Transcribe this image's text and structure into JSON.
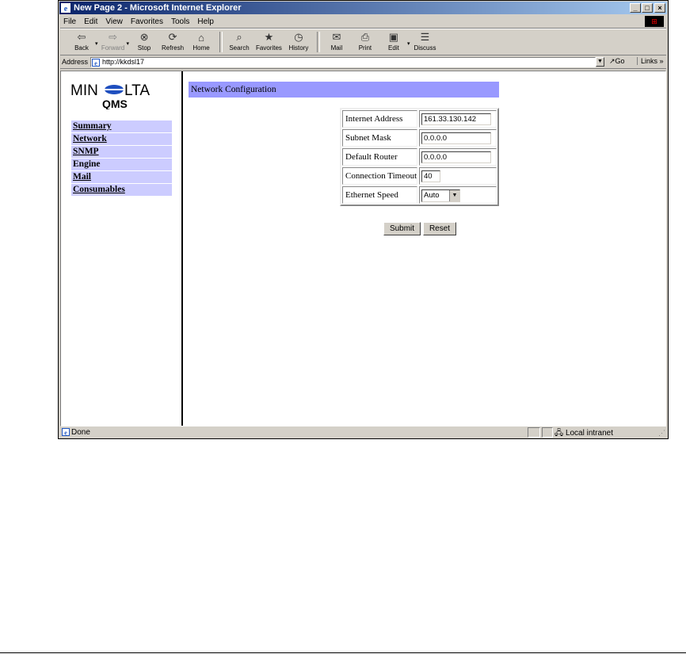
{
  "window": {
    "title": "New Page 2 - Microsoft Internet Explorer",
    "minimize": "_",
    "maximize": "□",
    "close": "×"
  },
  "menu": [
    "File",
    "Edit",
    "View",
    "Favorites",
    "Tools",
    "Help"
  ],
  "toolbar": {
    "back": "Back",
    "forward": "Forward",
    "stop": "Stop",
    "refresh": "Refresh",
    "home": "Home",
    "search": "Search",
    "favorites": "Favorites",
    "history": "History",
    "mail": "Mail",
    "print": "Print",
    "edit": "Edit",
    "discuss": "Discuss"
  },
  "address": {
    "label": "Address",
    "url": "http://kkdsl17",
    "go": "Go",
    "links": "Links »"
  },
  "logo": {
    "line1": "MINOLTA",
    "line2": "QMS"
  },
  "nav": [
    "Summary",
    "Network",
    "SNMP",
    "Engine",
    "Mail",
    "Consumables"
  ],
  "page": {
    "heading": "Network Configuration",
    "fields": [
      {
        "label": "Internet Address",
        "value": "161.33.130.142"
      },
      {
        "label": "Subnet Mask",
        "value": "0.0.0.0"
      },
      {
        "label": "Default Router",
        "value": "0.0.0.0"
      },
      {
        "label": "Connection Timeout",
        "value": "40"
      },
      {
        "label": "Ethernet Speed",
        "value": "Auto"
      }
    ],
    "submit": "Submit",
    "reset": "Reset"
  },
  "status": {
    "text": "Done",
    "zone": "Local intranet"
  },
  "colors": {
    "titlebar_start": "#0a246a",
    "titlebar_end": "#a6caf0",
    "nav_bg": "#ccccff",
    "heading_bg": "#9999ff",
    "chrome": "#d4d0c8"
  }
}
